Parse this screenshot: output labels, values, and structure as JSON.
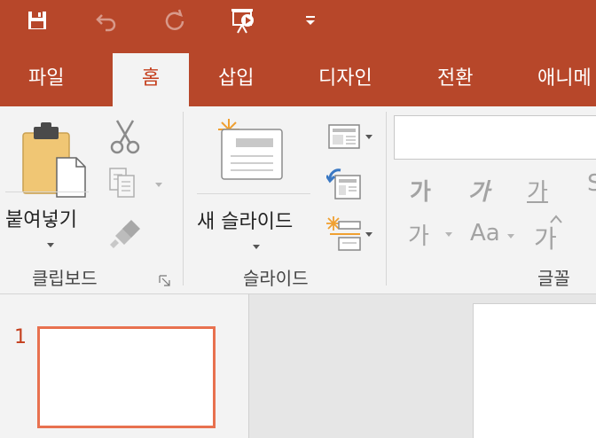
{
  "quick_access": {
    "items": [
      "save-icon",
      "undo-icon",
      "redo-icon",
      "start-slideshow-icon",
      "customize-dropdown-icon"
    ]
  },
  "tabs": [
    {
      "label": "파일",
      "active": false
    },
    {
      "label": "홈",
      "active": true
    },
    {
      "label": "삽입",
      "active": false
    },
    {
      "label": "디자인",
      "active": false
    },
    {
      "label": "전환",
      "active": false
    },
    {
      "label": "애니메"
    }
  ],
  "clipboard": {
    "paste_label": "붙여넣기",
    "group_label": "클립보드"
  },
  "slides": {
    "new_slide_label": "새 슬라이드",
    "group_label": "슬라이드"
  },
  "font": {
    "group_label": "글꼴",
    "bold": "가",
    "italic": "가",
    "underline": "가",
    "shrink": "가",
    "case": "Aa",
    "grow": "가"
  },
  "thumbnails": [
    {
      "number": "1"
    }
  ],
  "colors": {
    "accent": "#b7472a",
    "active_tab_text": "#c43e1c",
    "thumb_border": "#e8714f"
  }
}
